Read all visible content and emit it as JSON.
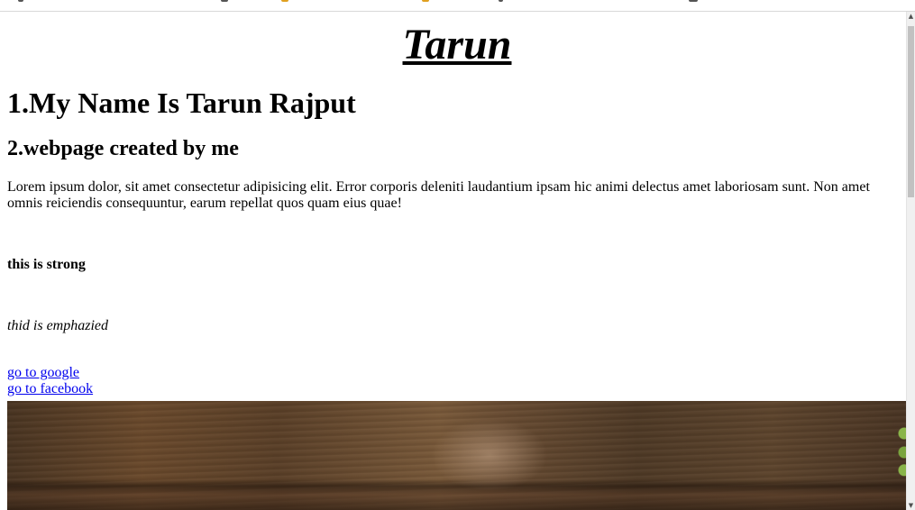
{
  "page": {
    "banner_title": "Tarun",
    "heading_1": "1.My Name Is Tarun Rajput",
    "heading_2": "2.webpage created by me",
    "paragraph": "Lorem ipsum dolor, sit amet consectetur adipisicing elit. Error corporis deleniti laudantium ipsam hic animi delectus amet laboriosam sunt. Non amet omnis reiciendis consequuntur, earum repellat quos quam eius quae!",
    "strong_text": "this is strong",
    "emphasized_text": "thid is emphazied",
    "links": [
      {
        "label": "go to google"
      },
      {
        "label": "go to facebook"
      }
    ]
  },
  "image": {
    "subject": "wooden table surface"
  },
  "scrollbar": {
    "up_arrow": "▲",
    "down_arrow": "▼"
  },
  "colors": {
    "link": "#0000ee",
    "text": "#000000",
    "background": "#ffffff"
  }
}
